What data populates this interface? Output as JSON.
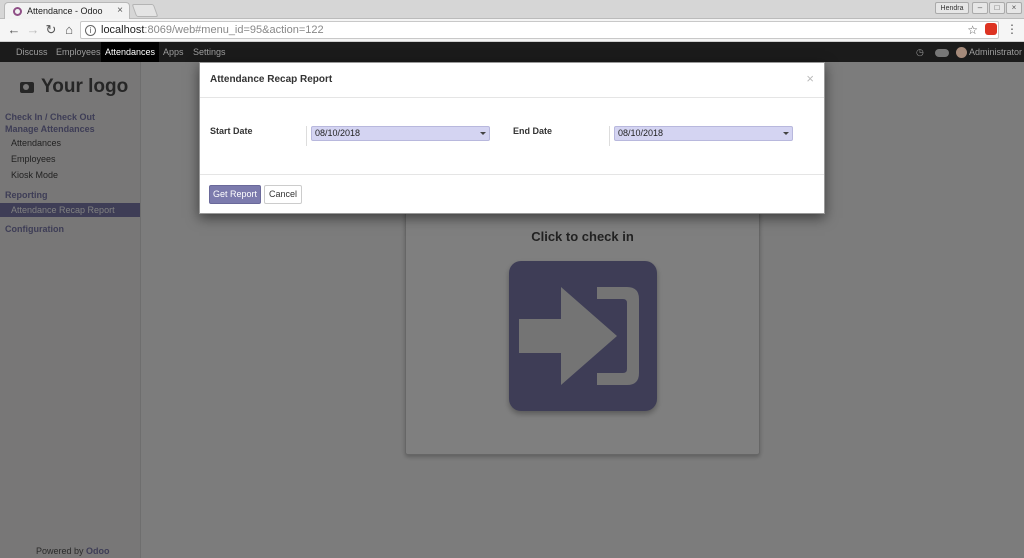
{
  "browser": {
    "tab_title": "Attendance - Odoo",
    "tab_close": "×",
    "window_user": "Hendra",
    "url_host": "localhost",
    "url_path": ":8069/web#menu_id=95&action=122"
  },
  "navbar": {
    "items": [
      "Discuss",
      "Employees",
      "Attendances",
      "Apps",
      "Settings"
    ],
    "active": "Attendances",
    "user": "Administrator"
  },
  "sidebar": {
    "logo_text": "Your logo",
    "check_in_out": "Check In / Check Out",
    "manage_attendances": "Manage Attendances",
    "items_manage": [
      "Attendances",
      "Employees",
      "Kiosk Mode"
    ],
    "reporting": "Reporting",
    "reporting_item": "Attendance Recap Report",
    "configuration": "Configuration",
    "powered_by": "Powered by",
    "powered_brand": "Odoo"
  },
  "kiosk": {
    "title": "Click to check in",
    "icon": "sign-in-icon"
  },
  "modal": {
    "title": "Attendance Recap Report",
    "close": "×",
    "start_label": "Start Date",
    "start_value": "08/10/2018",
    "end_label": "End Date",
    "end_value": "08/10/2018",
    "primary_button": "Get Report",
    "cancel_button": "Cancel"
  },
  "colors": {
    "accent": "#7c7bad",
    "navbar": "#1b1b1b",
    "input_bg": "#d4d4f2"
  }
}
